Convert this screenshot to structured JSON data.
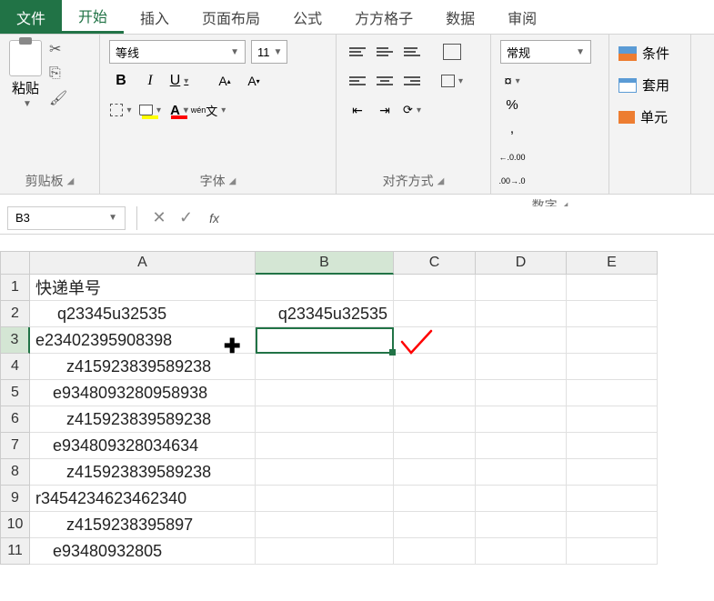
{
  "tabs": {
    "file": "文件",
    "home": "开始",
    "insert": "插入",
    "page_layout": "页面布局",
    "formulas": "公式",
    "fangfang": "方方格子",
    "data": "数据",
    "review": "审阅"
  },
  "ribbon": {
    "clipboard": {
      "paste": "粘贴",
      "label": "剪贴板"
    },
    "font": {
      "name": "等线",
      "size": "11",
      "wen": "wén",
      "wen2": "文",
      "label": "字体"
    },
    "align": {
      "label": "对齐方式"
    },
    "number": {
      "format": "常规",
      "percent": "%",
      "comma": ",",
      "inc_dec": ".00",
      "dec_dec": ".0",
      "label": "数字"
    },
    "styles": {
      "cond": "条件",
      "table": "套用",
      "cell": "单元"
    }
  },
  "namebox": "B3",
  "fx": "fx",
  "columns": [
    "A",
    "B",
    "C",
    "D",
    "E"
  ],
  "cells": {
    "A1": "快递单号",
    "A2": "q23345u32535",
    "A3": "e23402395908398",
    "A4": "z415923839589238",
    "A5": "e9348093280958938",
    "A6": "z415923839589238",
    "A7": "e934809328034634",
    "A8": "z415923839589238",
    "A9": "r3454234623462340",
    "A10": "z4159238395897",
    "A11": "e93480932805",
    "B2": "q23345u32535"
  },
  "chart_data": null
}
